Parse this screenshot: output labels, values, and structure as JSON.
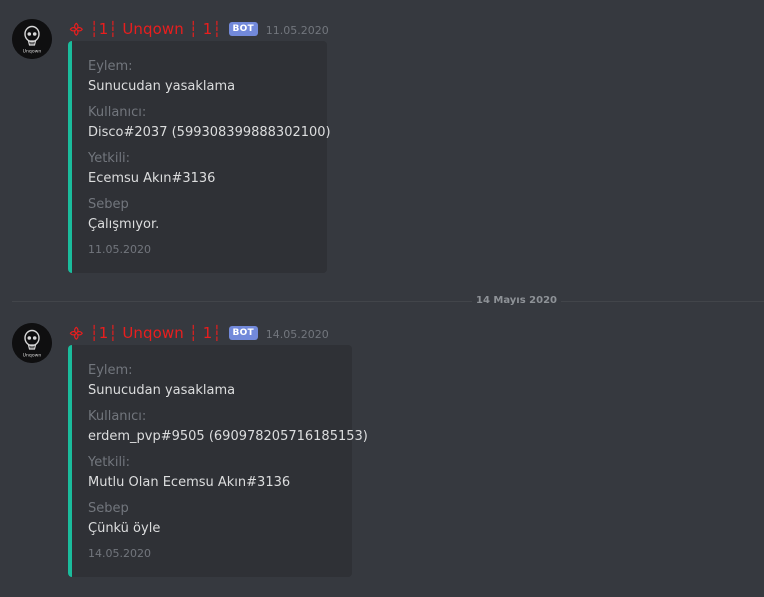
{
  "messages": [
    {
      "avatar_icon": "skull-logo-icon",
      "avatar_text": "Unqown",
      "username": "᯽ ┆1┆ Unqown ┆ 1┆",
      "bot_tag": "BOT",
      "timestamp": "11.05.2020",
      "embed": {
        "accent_color": "#1abc9c",
        "fields": [
          {
            "name": "Eylem:",
            "value": "Sunucudan yasaklama"
          },
          {
            "name": "Kullanıcı:",
            "value": "Disco#2037 (599308399888302100)"
          },
          {
            "name": "Yetkili:",
            "value": "Ecemsu Akın#3136"
          },
          {
            "name": "Sebep",
            "value": "Çalışmıyor."
          }
        ],
        "footer": "11.05.2020"
      }
    },
    {
      "avatar_icon": "skull-logo-icon",
      "avatar_text": "Unqown",
      "username": "᯽ ┆1┆ Unqown ┆ 1┆",
      "bot_tag": "BOT",
      "timestamp": "14.05.2020",
      "embed": {
        "accent_color": "#1abc9c",
        "fields": [
          {
            "name": "Eylem:",
            "value": "Sunucudan yasaklama"
          },
          {
            "name": "Kullanıcı:",
            "value": "erdem_pvp#9505 (690978205716185153)"
          },
          {
            "name": "Yetkili:",
            "value": "Mutlu Olan Ecemsu Akın#3136"
          },
          {
            "name": "Sebep",
            "value": "Çünkü öyle"
          }
        ],
        "footer": "14.05.2020"
      }
    }
  ],
  "date_divider": "14 Mayıs 2020",
  "colors": {
    "background": "#36393f",
    "embed_background": "#2f3136",
    "username": "#e91e1e",
    "bot_tag": "#7289da"
  }
}
